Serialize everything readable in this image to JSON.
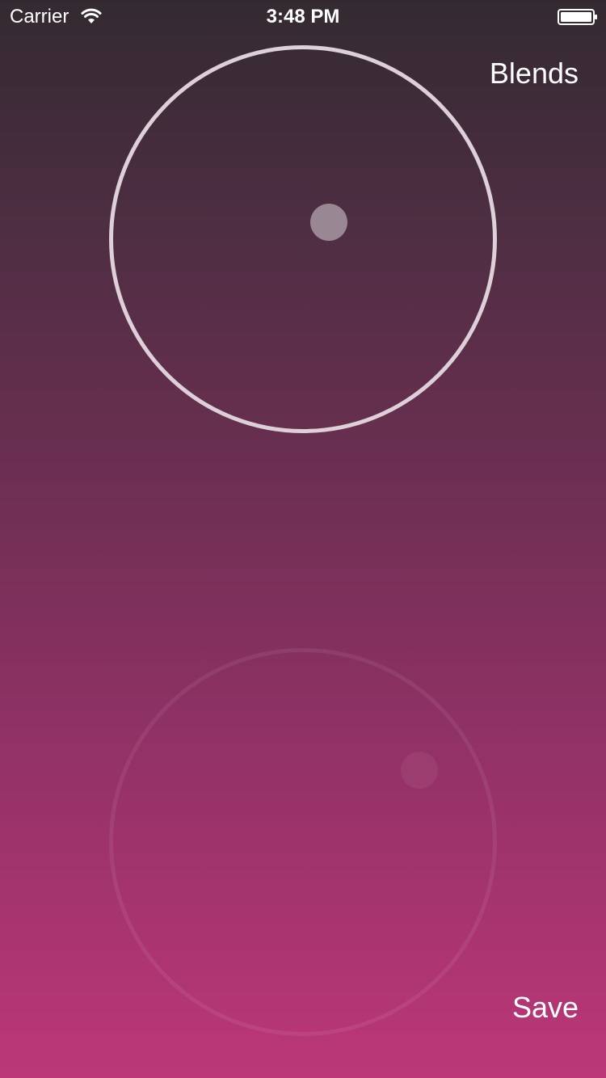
{
  "status_bar": {
    "carrier": "Carrier",
    "time": "3:48 PM",
    "wifi_icon": "wifi-icon",
    "battery_icon": "battery-full-icon"
  },
  "nav": {
    "blends_label": "Blends",
    "save_label": "Save"
  },
  "colors": {
    "gradient_top": "#332a31",
    "gradient_bottom": "#bc3778",
    "active_ring": "#ddd0d9",
    "active_handle": "#998893"
  },
  "pads": [
    {
      "name": "top-blend-pad",
      "state": "active"
    },
    {
      "name": "bottom-blend-pad",
      "state": "inactive"
    }
  ]
}
